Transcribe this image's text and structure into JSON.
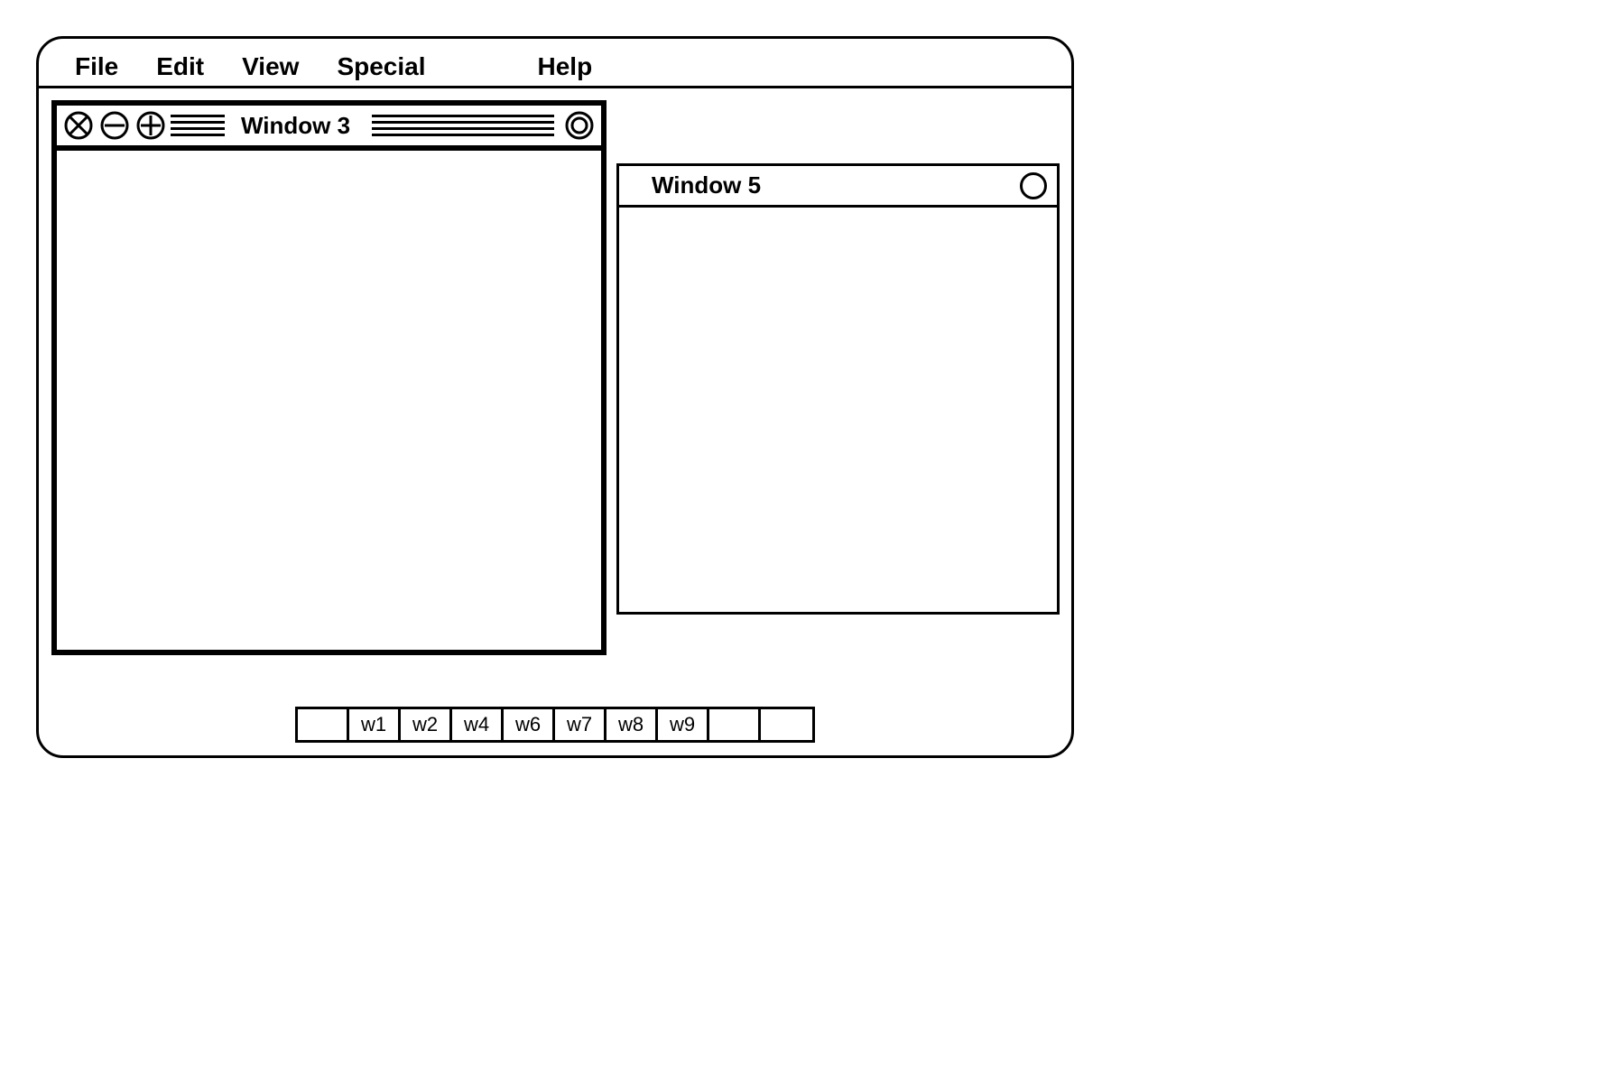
{
  "menubar": {
    "items": [
      "File",
      "Edit",
      "View",
      "Special",
      "Help"
    ]
  },
  "windows": {
    "window3": {
      "title": "Window 3"
    },
    "window5": {
      "title": "Window 5"
    }
  },
  "taskbar": {
    "items": [
      "",
      "w1",
      "w2",
      "w4",
      "w6",
      "w7",
      "w8",
      "w9",
      "",
      ""
    ]
  }
}
